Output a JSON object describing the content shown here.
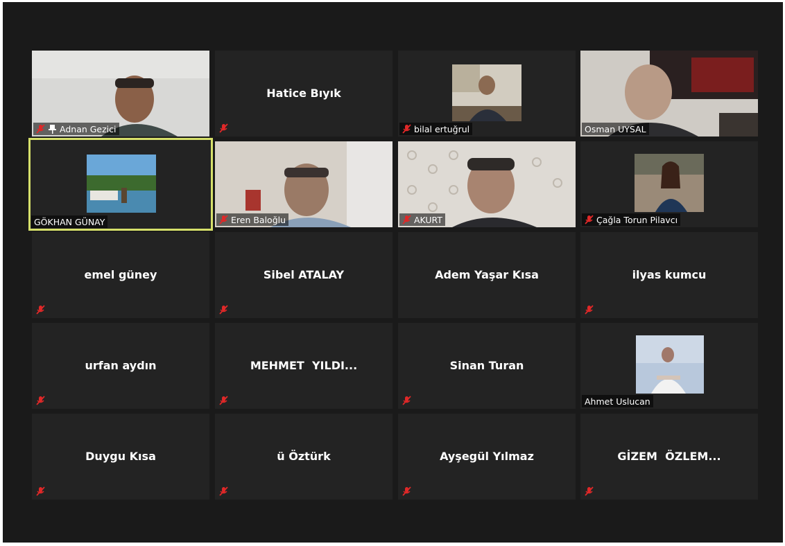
{
  "meeting": {
    "participants": [
      {
        "name": "Adnan Gezici",
        "video": true,
        "muted": true,
        "pinned": true
      },
      {
        "name": "Hatice Bıyık",
        "video": false,
        "muted": true
      },
      {
        "name": "bilal ertuğrul",
        "video": true,
        "muted": true
      },
      {
        "name": "Osman UYSAL",
        "video": true,
        "muted": false
      },
      {
        "name": "GÖKHAN GÜNAY",
        "video": true,
        "muted": false,
        "active_speaker": true
      },
      {
        "name": "Eren Baloğlu",
        "video": true,
        "muted": true
      },
      {
        "name": "AKURT",
        "video": true,
        "muted": true
      },
      {
        "name": "Çağla Torun Pilavcı",
        "video": true,
        "muted": true
      },
      {
        "name": "emel güney",
        "video": false,
        "muted": true
      },
      {
        "name": "Sibel ATALAY",
        "video": false,
        "muted": true
      },
      {
        "name": "Adem Yaşar Kısa",
        "video": false,
        "muted": false
      },
      {
        "name": "ilyas kumcu",
        "video": false,
        "muted": true
      },
      {
        "name": "urfan aydın",
        "video": false,
        "muted": true
      },
      {
        "name": "MEHMET  YILDI...",
        "video": false,
        "muted": true
      },
      {
        "name": "Sinan Turan",
        "video": false,
        "muted": true
      },
      {
        "name": "Ahmet Uslucan",
        "video": true,
        "muted": false
      },
      {
        "name": "Duygu Kısa",
        "video": false,
        "muted": true
      },
      {
        "name": "ü Öztürk",
        "video": false,
        "muted": true
      },
      {
        "name": "Ayşegül Yılmaz",
        "video": false,
        "muted": true
      },
      {
        "name": "GİZEM  ÖZLEM...",
        "video": false,
        "muted": true
      }
    ]
  },
  "icons": {
    "mute": "muted-mic-icon",
    "pin": "pin-icon"
  },
  "colors": {
    "background": "#1a1a1a",
    "tile": "#232323",
    "active_border": "#d6e06a",
    "mute_red": "#e02828"
  }
}
